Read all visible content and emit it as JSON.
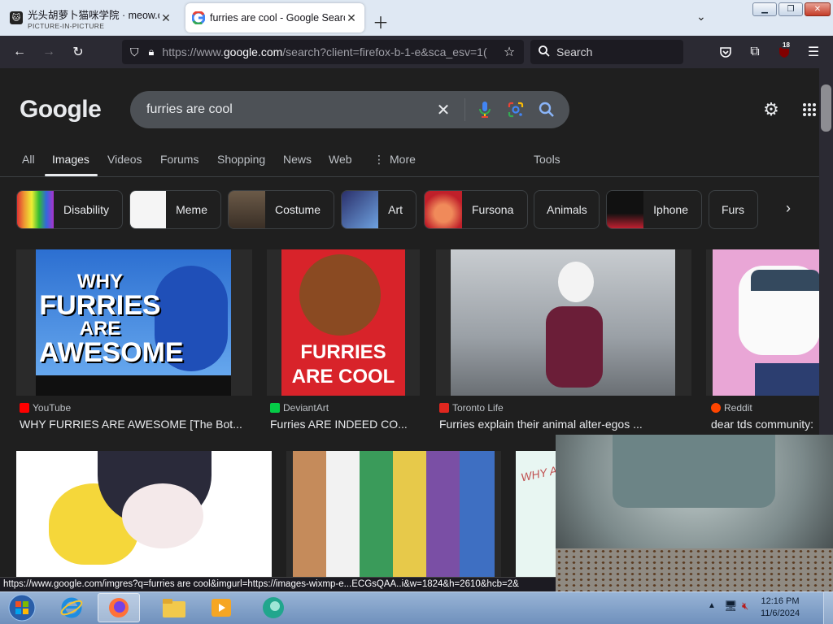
{
  "browser": {
    "tabs": [
      {
        "title": "光头胡萝卜猫咪学院 · meow.ca",
        "subtitle": "PICTURE-IN-PICTURE",
        "favicon_icon": "cat-icon"
      },
      {
        "title": "furries are cool - Google Search",
        "favicon_icon": "google-icon",
        "active": true
      }
    ],
    "window_controls": [
      "minimize",
      "maximize",
      "close"
    ],
    "url": {
      "prefix": "https://www.",
      "domain": "google.com",
      "rest": "/search?client=firefox-b-1-e&sca_esv=1("
    },
    "search_placeholder": "Search",
    "extension_badge": "18",
    "status_url": "https://www.google.com/imgres?q=furries are cool&imgurl=https://images-wixmp-e...ECGsQAA..i&w=1824&h=2610&hcb=2&"
  },
  "google": {
    "logo": "Google",
    "query": "furries are cool",
    "tabs": [
      "All",
      "Images",
      "Videos",
      "Forums",
      "Shopping",
      "News",
      "Web",
      "More",
      "Tools"
    ],
    "active_tab": "Images",
    "chips": [
      "Disability",
      "Meme",
      "Costume",
      "Art",
      "Fursona",
      "Animals",
      "Iphone",
      "Furs"
    ],
    "results": [
      {
        "source": "YouTube",
        "title": "WHY FURRIES ARE AWESOME [The Bot...",
        "image_text": [
          "WHY",
          "FURRIES",
          "ARE",
          "AWESOME"
        ],
        "source_color": "#ff0000"
      },
      {
        "source": "DeviantArt",
        "title": "Furries ARE INDEED CO...",
        "image_text": [
          "FURRIES",
          "ARE COOL"
        ],
        "source_color": "#05cc47"
      },
      {
        "source": "Toronto Life",
        "title": "Furries explain their animal alter-egos ...",
        "source_color": "#e0271f"
      },
      {
        "source": "Reddit",
        "title": "dear tds community:",
        "source_color": "#ff4500"
      }
    ],
    "row2_snippet_text": "WHY A"
  },
  "taskbar": {
    "apps": [
      "start-orb",
      "internet-explorer",
      "firefox",
      "file-explorer",
      "media-player",
      "app-green"
    ],
    "time": "12:16 PM",
    "date": "11/6/2024"
  },
  "colors": {
    "page_bg": "#1f1f1f",
    "search_bg": "#4d5156",
    "text": "#e8eaed",
    "muted": "#bdc1c6"
  }
}
